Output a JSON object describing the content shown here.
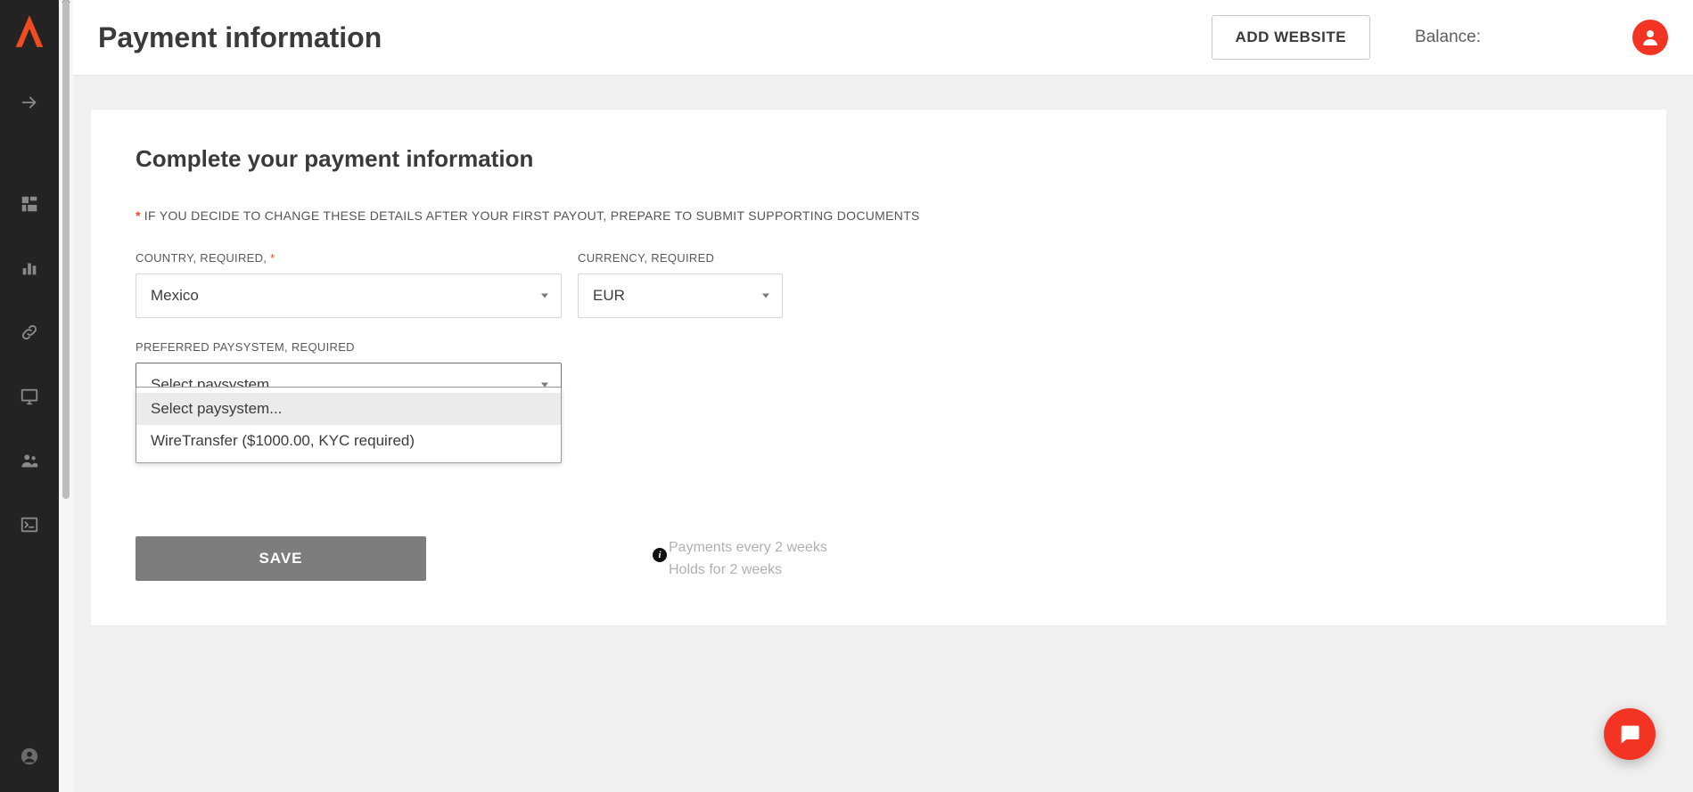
{
  "header": {
    "page_title": "Payment information",
    "add_website_label": "ADD WEBSITE",
    "balance_label": "Balance:"
  },
  "card": {
    "title": "Complete your payment information",
    "warning": "IF YOU DECIDE TO CHANGE THESE DETAILS AFTER YOUR FIRST PAYOUT, PREPARE TO SUBMIT SUPPORTING DOCUMENTS"
  },
  "fields": {
    "country": {
      "label": "COUNTRY, REQUIRED, ",
      "value": "Mexico"
    },
    "currency": {
      "label": "CURRENCY, REQUIRED",
      "value": "EUR"
    },
    "paysystem": {
      "label": "PREFERRED PAYSYSTEM, REQUIRED",
      "value": "Select paysystem...",
      "options": {
        "placeholder": "Select paysystem...",
        "wire": "WireTransfer ($1000.00, KYC required)"
      }
    }
  },
  "schedule": {
    "line1": "Payments every 2 weeks",
    "line2": "Holds for 2 weeks"
  },
  "buttons": {
    "save": "SAVE"
  },
  "colors": {
    "accent": "#f04b23"
  }
}
